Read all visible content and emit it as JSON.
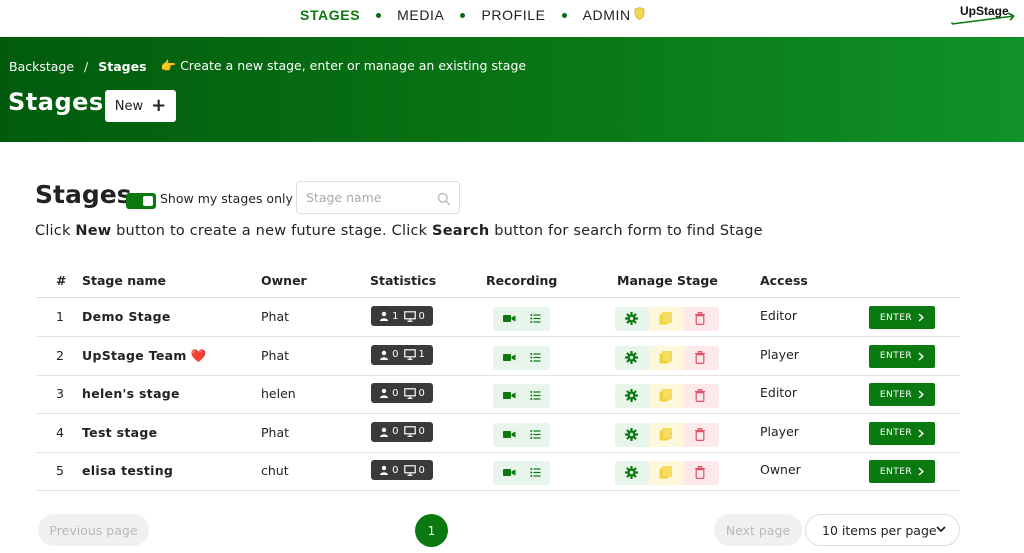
{
  "nav": {
    "items": [
      "STAGES",
      "MEDIA",
      "PROFILE",
      "ADMIN"
    ],
    "active": "STAGES",
    "logo_text": "UpStage"
  },
  "hero": {
    "breadcrumb_root": "Backstage",
    "breadcrumb_sep": "/",
    "breadcrumb_current": "Stages",
    "breadcrumb_hint": "👉 Create a new stage, enter or manage an existing stage",
    "title": "Stages",
    "new_label": "New"
  },
  "section": {
    "title": "Stages",
    "toggle_label": "Show my stages only",
    "toggle_on": true,
    "search_placeholder": "Stage name",
    "help_part1": "Click ",
    "help_new": "New",
    "help_part2": " button to create a new future stage. Click ",
    "help_search": "Search",
    "help_part3": " button for search form to find Stage"
  },
  "table": {
    "headers": [
      "#",
      "Stage name",
      "Owner",
      "Statistics",
      "Recording",
      "Manage Stage",
      "Access"
    ],
    "rows": [
      {
        "num": "1",
        "name": "Demo Stage",
        "heart": "",
        "owner": "Phat",
        "players": "1",
        "audience": "0",
        "access": "Editor",
        "enter": "ENTER"
      },
      {
        "num": "2",
        "name": "UpStage Team",
        "heart": "❤️",
        "owner": "Phat",
        "players": "0",
        "audience": "1",
        "access": "Player",
        "enter": "ENTER"
      },
      {
        "num": "3",
        "name": "helen's stage",
        "heart": "",
        "owner": "helen",
        "players": "0",
        "audience": "0",
        "access": "Editor",
        "enter": "ENTER"
      },
      {
        "num": "4",
        "name": "Test stage",
        "heart": "",
        "owner": "Phat",
        "players": "0",
        "audience": "0",
        "access": "Player",
        "enter": "ENTER"
      },
      {
        "num": "5",
        "name": "elisa testing",
        "heart": "",
        "owner": "chut",
        "players": "0",
        "audience": "0",
        "access": "Owner",
        "enter": "ENTER"
      }
    ]
  },
  "pagination": {
    "prev": "Previous page",
    "current": "1",
    "next": "Next page",
    "per_page": "10 items per page"
  },
  "colors": {
    "brand_green": "#0a7a10",
    "hero_dark": "#025b0d",
    "hero_light": "#10912a",
    "shield": "#e8c32a",
    "delete": "#e0506a",
    "clone": "#f2d23a"
  },
  "icons": {
    "stats_players": "user-icon",
    "stats_audience": "monitor-icon",
    "record": "video-camera-icon",
    "recordings_list": "list-icon",
    "settings": "gear-icon",
    "clone": "copy-icon",
    "delete": "trash-icon",
    "enter": "chevron-right-icon",
    "search": "search-icon",
    "admin": "shield-icon"
  }
}
